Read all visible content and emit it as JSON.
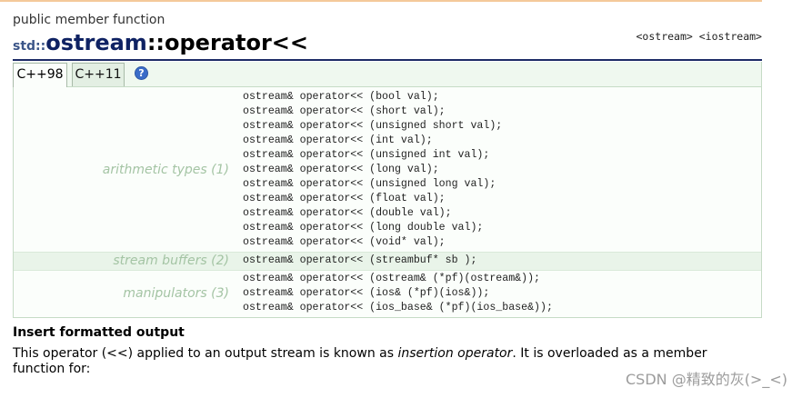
{
  "header": {
    "kind": "public member function",
    "namespace": "std::",
    "class_name": "ostream",
    "member": "::operator<<",
    "headers": [
      "<ostream>",
      "<iostream>"
    ]
  },
  "tabs": [
    {
      "label": "C++98",
      "active": true
    },
    {
      "label": "C++11",
      "active": false
    }
  ],
  "help": {
    "icon": "help-icon",
    "glyph": "?"
  },
  "prototypes": [
    {
      "label": "arithmetic types (1)",
      "lines": [
        "ostream& operator<< (bool val);",
        "ostream& operator<< (short val);",
        "ostream& operator<< (unsigned short val);",
        "ostream& operator<< (int val);",
        "ostream& operator<< (unsigned int val);",
        "ostream& operator<< (long val);",
        "ostream& operator<< (unsigned long val);",
        "ostream& operator<< (float val);",
        "ostream& operator<< (double val);",
        "ostream& operator<< (long double val);",
        "ostream& operator<< (void* val);"
      ]
    },
    {
      "label": "stream buffers (2)",
      "lines": [
        "ostream& operator<< (streambuf* sb );"
      ]
    },
    {
      "label": "manipulators (3)",
      "lines": [
        "ostream& operator<< (ostream& (*pf)(ostream&));",
        "ostream& operator<< (ios& (*pf)(ios&));",
        "ostream& operator<< (ios_base& (*pf)(ios_base&));"
      ]
    }
  ],
  "section": {
    "title": "Insert formatted output",
    "text_before": "This operator (<<) applied to an output stream is known as ",
    "emphasis": "insertion operator",
    "text_after": ". It is overloaded as a member function for:"
  },
  "watermark": "CSDN @精致的灰(>_<)",
  "colors": {
    "top-rule": "#f4c99a",
    "title-rule": "#1d2b66",
    "class-name": "#0f2263",
    "namespace": "#3b5588",
    "group-label": "#a4c4a4",
    "stream-row": "#e9f4e9",
    "box-border": "#c6dbc6",
    "help-icon": "#3a6cc8"
  }
}
